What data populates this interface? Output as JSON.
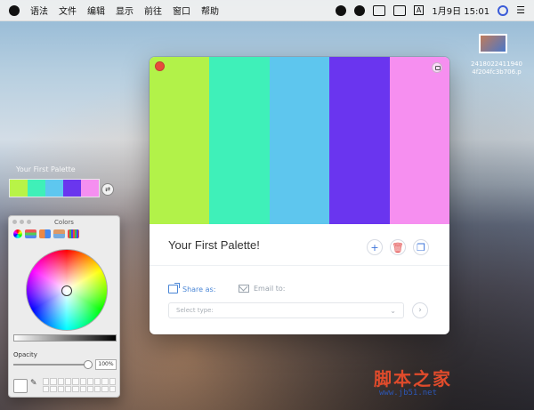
{
  "menubar": {
    "apple_icon": "apple-icon",
    "items": [
      "语法",
      "文件",
      "编辑",
      "显示",
      "前往",
      "窗口",
      "帮助"
    ],
    "clock": "1月9日  15:01",
    "status_icons": [
      "creative-cloud-icon",
      "alien-icon",
      "mail-icon",
      "display-icon",
      "input-method-icon",
      "wifi-icon",
      "siri-icon",
      "control-icon"
    ],
    "input_method": "A"
  },
  "desktop_file": {
    "name": "2418022411940 4f204fc3b706.p"
  },
  "desktop_strip": {
    "label": "Your First Palette",
    "colors": [
      "#b8f347",
      "#3ff0b8",
      "#5ec7ef",
      "#6a36ee",
      "#f58ff0"
    ]
  },
  "app": {
    "palette_title": "Your First Palette!",
    "swatch_colors": [
      "#b2f249",
      "#3ff0b9",
      "#5ec6ee",
      "#6a35ef",
      "#f68ff0"
    ],
    "buttons": {
      "add": "+",
      "delete": "🗑",
      "copy": "❐"
    },
    "share_label": "Share as:",
    "email_label": "Email to:",
    "select_placeholder": "Select type:",
    "go_icon": "arrow-right-icon"
  },
  "colors_panel": {
    "title": "Colors",
    "opacity_label": "Opacity",
    "opacity_value": "100%",
    "opacity": 1.0,
    "selected_color": "#ffffff"
  },
  "watermark": {
    "text": "脚本之家",
    "url": "www.jb51.net"
  }
}
